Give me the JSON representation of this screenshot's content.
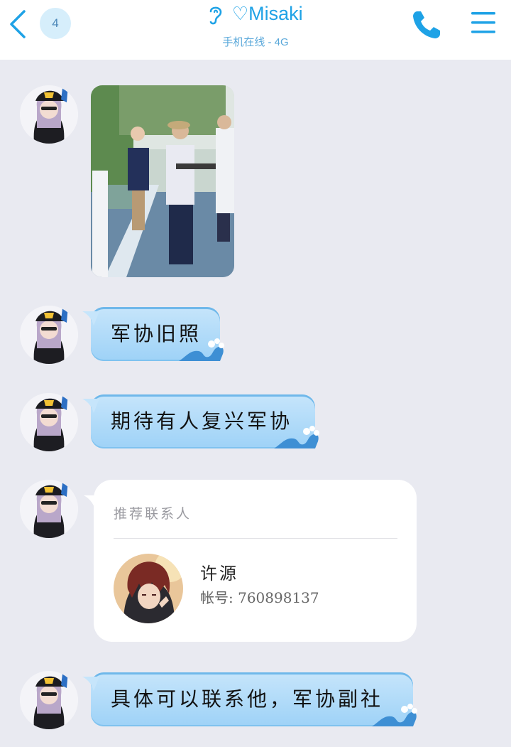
{
  "header": {
    "unread_count": "4",
    "title_heart": "♡",
    "title_name": "Misaki",
    "status": "手机在线 - 4G"
  },
  "messages": [
    {
      "type": "image"
    },
    {
      "type": "text",
      "text": "军协旧照"
    },
    {
      "type": "text",
      "text": "期待有人复兴军协"
    },
    {
      "type": "contact_card",
      "card_title": "推荐联系人",
      "contact_name": "许源",
      "account": "帐号: 760898137"
    },
    {
      "type": "text",
      "text": "具体可以联系他，军协副社"
    }
  ],
  "colors": {
    "accent": "#1ea2e6",
    "bubble": "#a9d8f8",
    "background": "#e9eaf1"
  }
}
